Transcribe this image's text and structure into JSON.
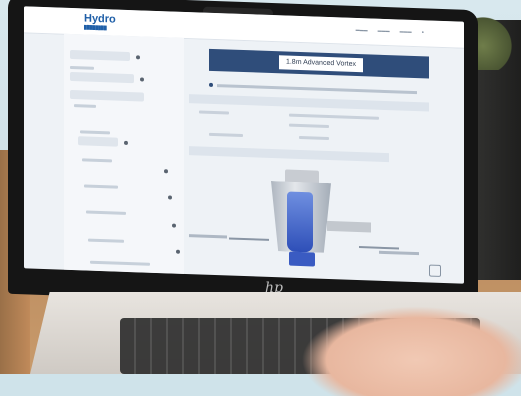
{
  "app": {
    "brand_name": "Hydro",
    "page_title": "1.8m Advanced Vortex"
  },
  "laptop": {
    "logo_text": "hp"
  },
  "colors": {
    "brand_blue": "#1f5fa8",
    "title_bar": "#2f4d7a",
    "vortex_blue": "#2e4fb8"
  }
}
